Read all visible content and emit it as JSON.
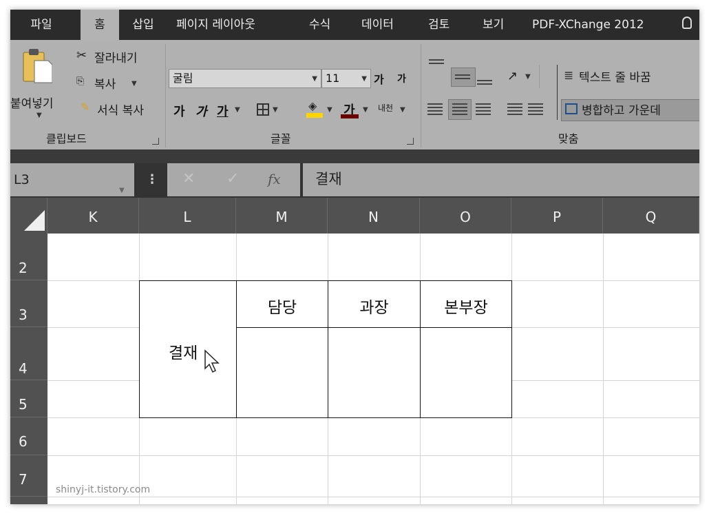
{
  "tabs": [
    "파일",
    "홈",
    "삽입",
    "페이지 레이아웃",
    "수식",
    "데이터",
    "검토",
    "보기",
    "PDF-XChange 2012"
  ],
  "active_tab": "홈",
  "clipboard": {
    "paste": "붙여넣기",
    "cut": "잘라내기",
    "copy": "복사",
    "format_painter": "서식 복사",
    "group": "클립보드"
  },
  "font": {
    "name": "굴림",
    "size": "11",
    "grow": "가",
    "shrink": "가",
    "bold": "가",
    "italic": "가",
    "underline": "가",
    "color": "가",
    "phonetic": "내천",
    "group": "글꼴"
  },
  "alignment": {
    "wrap": "텍스트 줄 바꿈",
    "merge": "병합하고 가운데",
    "group": "맞춤"
  },
  "colors": {
    "fill": "#ffd500",
    "font_color": "#6b0000",
    "ribbon": "#b1b1b1",
    "tabbar": "#2b2b2b"
  },
  "formula_bar": {
    "name_box": "L3",
    "fx": "fx",
    "content": "결재"
  },
  "columns": [
    "K",
    "L",
    "M",
    "N",
    "O",
    "P",
    "Q"
  ],
  "rows": [
    "2",
    "3",
    "4",
    "5",
    "6",
    "7"
  ],
  "table": {
    "approval": "결재",
    "headers": [
      "담당",
      "과장",
      "본부장"
    ]
  },
  "watermark": "shinyj-it.tistory.com"
}
